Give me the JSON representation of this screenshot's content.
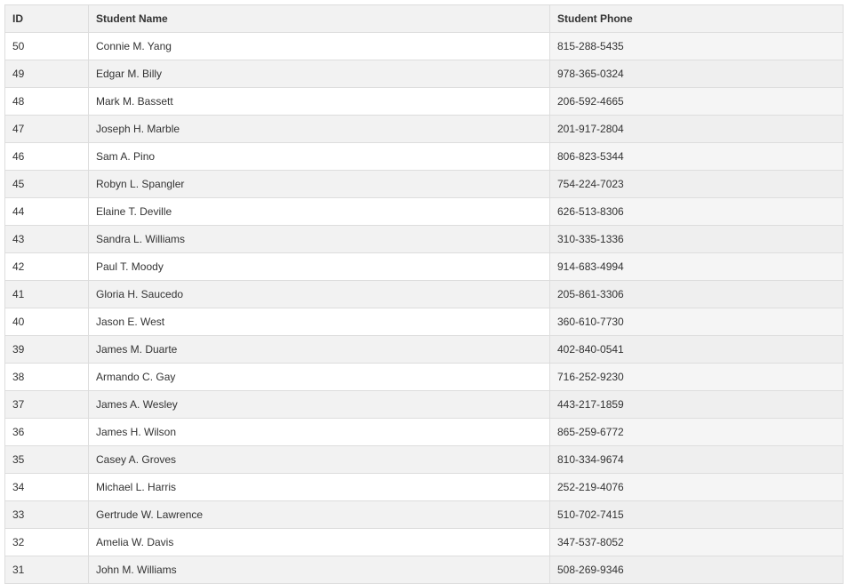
{
  "table": {
    "headers": [
      "ID",
      "Student Name",
      "Student Phone"
    ],
    "rows": [
      {
        "id": "50",
        "name": "Connie M. Yang",
        "phone": "815-288-5435"
      },
      {
        "id": "49",
        "name": "Edgar M. Billy",
        "phone": "978-365-0324"
      },
      {
        "id": "48",
        "name": "Mark M. Bassett",
        "phone": "206-592-4665"
      },
      {
        "id": "47",
        "name": "Joseph H. Marble",
        "phone": "201-917-2804"
      },
      {
        "id": "46",
        "name": "Sam A. Pino",
        "phone": "806-823-5344"
      },
      {
        "id": "45",
        "name": "Robyn L. Spangler",
        "phone": "754-224-7023"
      },
      {
        "id": "44",
        "name": "Elaine T. Deville",
        "phone": "626-513-8306"
      },
      {
        "id": "43",
        "name": "Sandra L. Williams",
        "phone": "310-335-1336"
      },
      {
        "id": "42",
        "name": "Paul T. Moody",
        "phone": "914-683-4994"
      },
      {
        "id": "41",
        "name": "Gloria H. Saucedo",
        "phone": "205-861-3306"
      },
      {
        "id": "40",
        "name": "Jason E. West",
        "phone": "360-610-7730"
      },
      {
        "id": "39",
        "name": "James M. Duarte",
        "phone": "402-840-0541"
      },
      {
        "id": "38",
        "name": "Armando C. Gay",
        "phone": "716-252-9230"
      },
      {
        "id": "37",
        "name": "James A. Wesley",
        "phone": "443-217-1859"
      },
      {
        "id": "36",
        "name": "James H. Wilson",
        "phone": "865-259-6772"
      },
      {
        "id": "35",
        "name": "Casey A. Groves",
        "phone": "810-334-9674"
      },
      {
        "id": "34",
        "name": "Michael L. Harris",
        "phone": "252-219-4076"
      },
      {
        "id": "33",
        "name": "Gertrude W. Lawrence",
        "phone": "510-702-7415"
      },
      {
        "id": "32",
        "name": "Amelia W. Davis",
        "phone": "347-537-8052"
      },
      {
        "id": "31",
        "name": "John M. Williams",
        "phone": "508-269-9346"
      }
    ]
  }
}
